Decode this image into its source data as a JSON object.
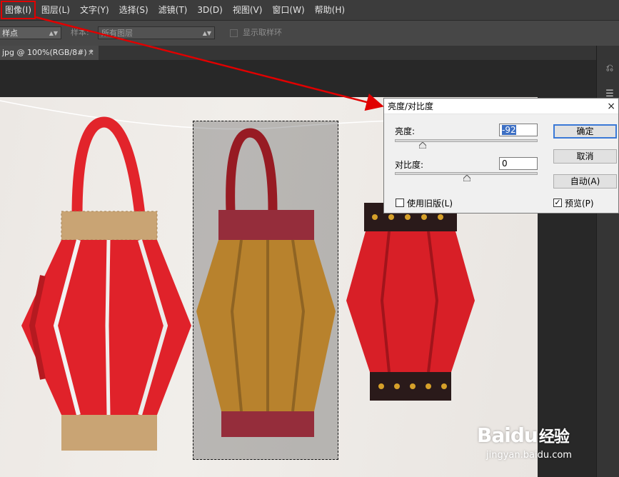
{
  "menu": [
    "图像(I)",
    "图层(L)",
    "文字(Y)",
    "选择(S)",
    "滤镜(T)",
    "3D(D)",
    "视图(V)",
    "窗口(W)",
    "帮助(H)"
  ],
  "options": {
    "sample_size": "样点",
    "sample_label": "样本:",
    "sample_value": "所有图层",
    "show_ring_label": "显示取样环"
  },
  "doc_tab": {
    "title": "jpg @ 100%(RGB/8#) *",
    "close": "×"
  },
  "dialog": {
    "title": "亮度/对比度",
    "close": "×",
    "brightness_label": "亮度:",
    "brightness_value": "-92",
    "contrast_label": "对比度:",
    "contrast_value": "0",
    "legacy_label": "使用旧版(L)",
    "legacy_checked": false,
    "preview_label": "预览(P)",
    "preview_checked": true,
    "ok_label": "确定",
    "cancel_label": "取消",
    "auto_label": "自动(A)"
  },
  "watermark": {
    "brand": "Baidu",
    "brand_cn": "经验",
    "url": "jingyan.baidu.com"
  },
  "colors": {
    "annotation_red": "#e00000",
    "lantern_red": "#e0222a",
    "lantern_orange": "#f0a530"
  }
}
